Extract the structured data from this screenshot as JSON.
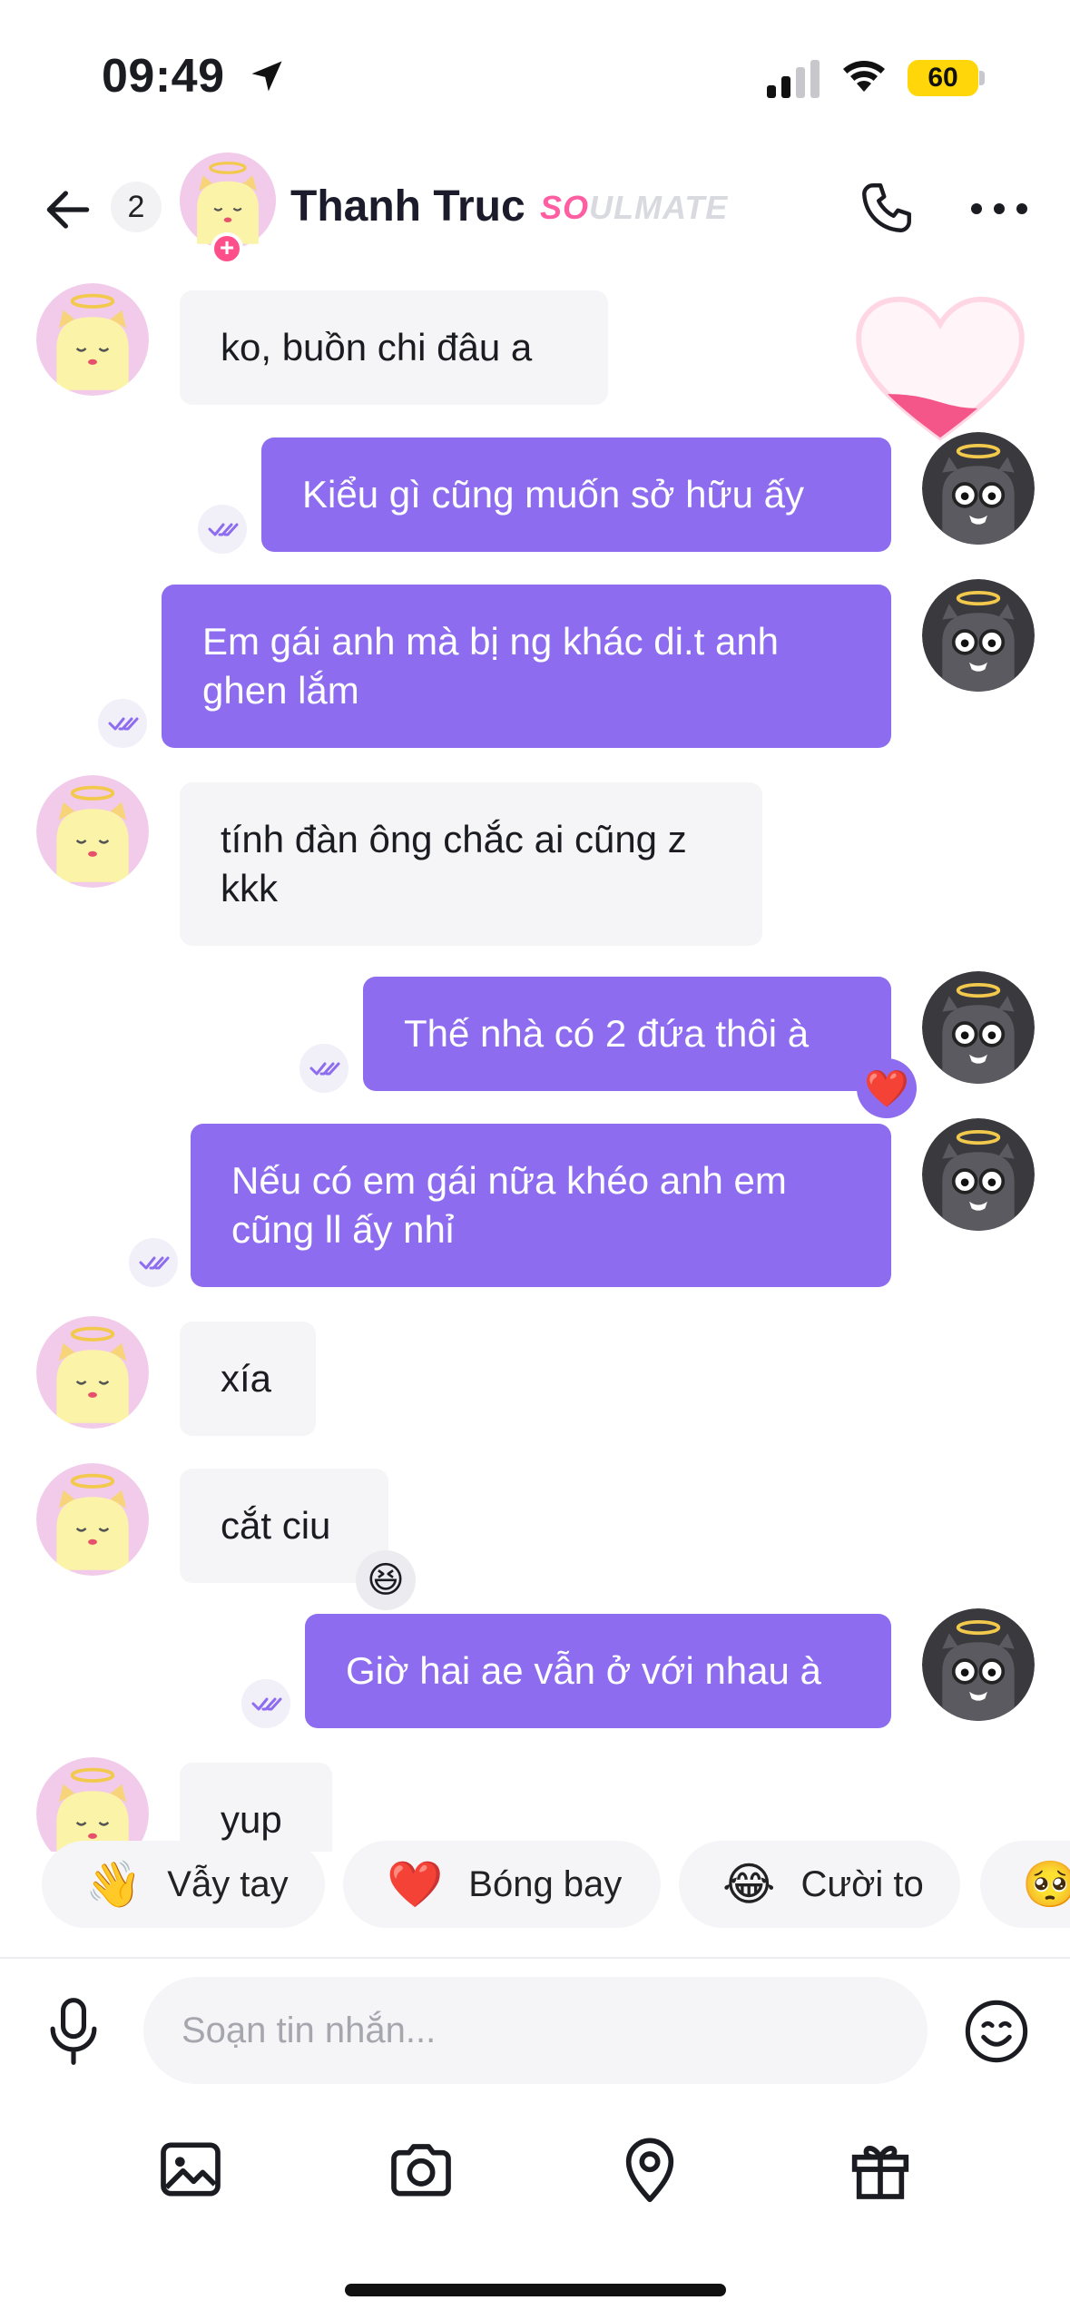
{
  "status_bar": {
    "time": "09:49",
    "battery": "60"
  },
  "header": {
    "unread_count": "2",
    "contact_name": "Thanh Truc",
    "tag_prefix": "SO",
    "tag_suffix": "ULMATE"
  },
  "messages": [
    {
      "side": "in",
      "text": "ko, buồn chi đâu a"
    },
    {
      "side": "out",
      "text": "Kiểu gì cũng muốn sở hữu ấy"
    },
    {
      "side": "out",
      "text": "Em gái anh mà bị ng khác di.t anh ghen lắm"
    },
    {
      "side": "in",
      "text": "tính đàn ông chắc ai cũng z kkk"
    },
    {
      "side": "out",
      "text": "Thế nhà có 2 đứa thôi à",
      "reaction": "❤️"
    },
    {
      "side": "out",
      "text": "Nếu có em gái nữa khéo anh em cũng ll ấy nhỉ"
    },
    {
      "side": "in",
      "text": "xía"
    },
    {
      "side": "in",
      "text": "cắt ciu",
      "reaction": "😆"
    },
    {
      "side": "out",
      "text": "Giờ hai ae vẫn ở với nhau à"
    },
    {
      "side": "in",
      "text": "yup"
    }
  ],
  "quick_reactions": [
    {
      "emoji": "👋",
      "label": "Vẫy tay"
    },
    {
      "emoji": "❤️",
      "label": "Bóng bay"
    },
    {
      "emoji": "😂",
      "label": "Cười to"
    },
    {
      "emoji": "🥺",
      "label": ""
    }
  ],
  "composer": {
    "placeholder": "Soạn tin nhắn..."
  },
  "toolbar": [
    "image-icon",
    "camera-icon",
    "location-icon",
    "gift-icon"
  ],
  "colors": {
    "accent": "#8d6cf0",
    "incoming_bg": "#f5f5f7",
    "pink": "#ff5fa2"
  }
}
